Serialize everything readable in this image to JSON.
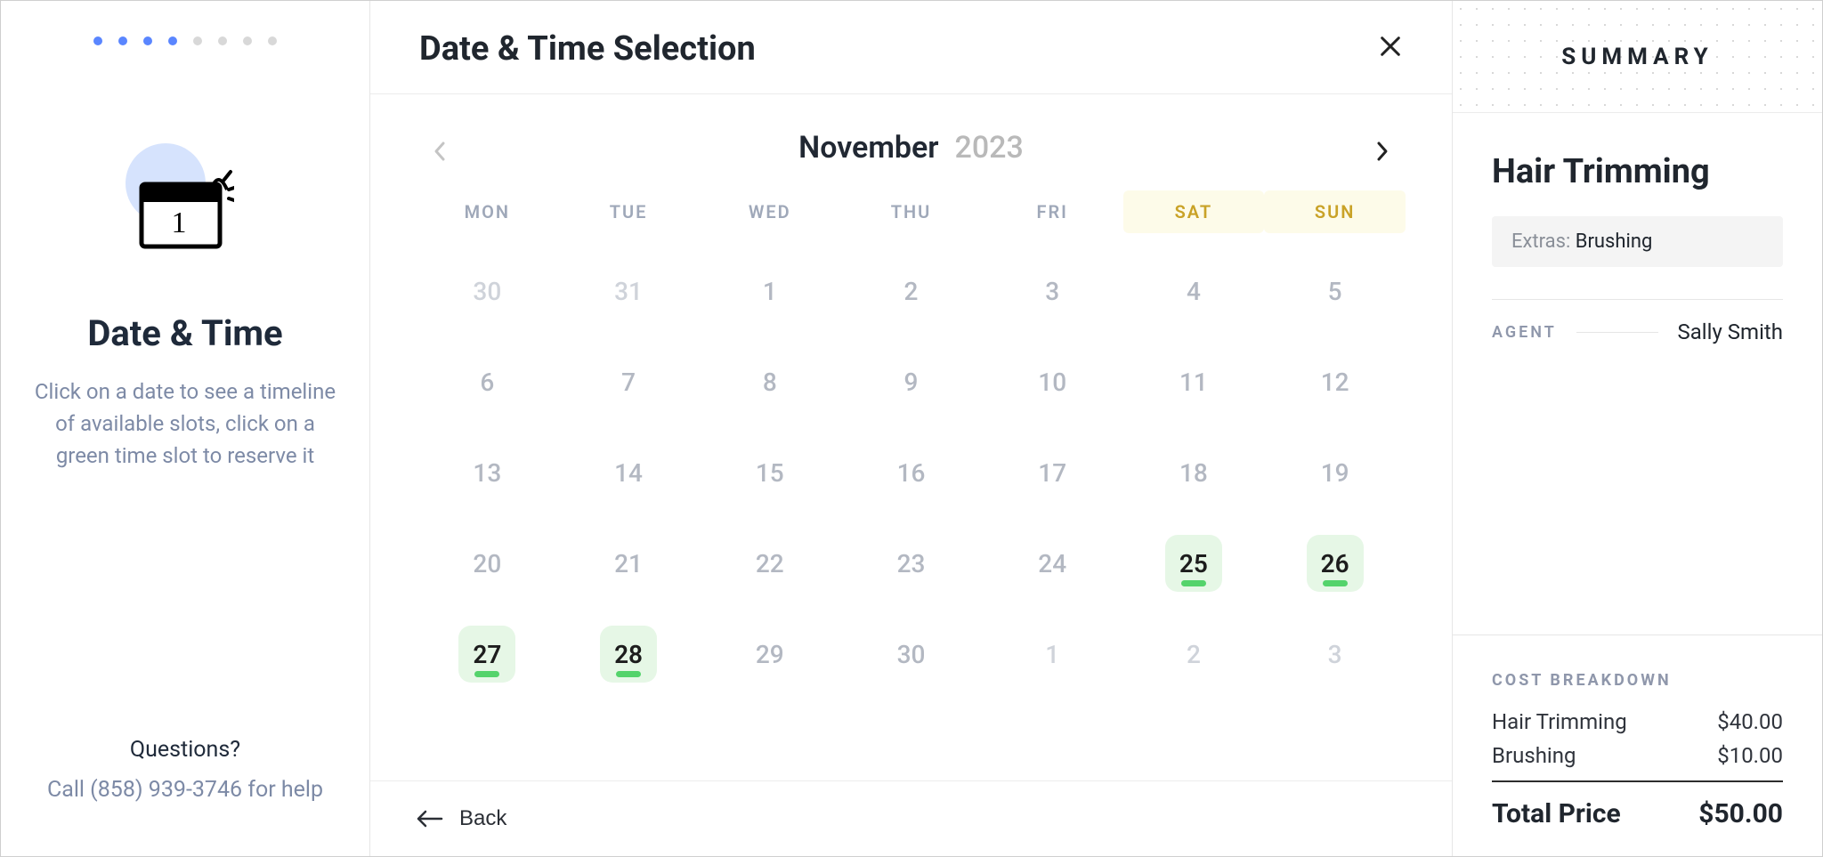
{
  "stepper": {
    "total": 8,
    "active": 4
  },
  "left": {
    "title": "Date & Time",
    "description": "Click on a date to see a timeline of available slots, click on a green time slot to reserve it",
    "questions": "Questions?",
    "help_line": "Call (858) 939-3746 for help"
  },
  "center": {
    "title": "Date & Time Selection",
    "back_label": "Back",
    "month": "November",
    "year": "2023",
    "weekdays": [
      "MON",
      "TUE",
      "WED",
      "THU",
      "FRI",
      "SAT",
      "SUN"
    ],
    "weekend_cols": [
      5,
      6
    ],
    "cells": [
      {
        "n": "30",
        "out": true
      },
      {
        "n": "31",
        "out": true
      },
      {
        "n": "1"
      },
      {
        "n": "2"
      },
      {
        "n": "3"
      },
      {
        "n": "4"
      },
      {
        "n": "5"
      },
      {
        "n": "6"
      },
      {
        "n": "7"
      },
      {
        "n": "8"
      },
      {
        "n": "9"
      },
      {
        "n": "10"
      },
      {
        "n": "11"
      },
      {
        "n": "12"
      },
      {
        "n": "13"
      },
      {
        "n": "14"
      },
      {
        "n": "15"
      },
      {
        "n": "16"
      },
      {
        "n": "17"
      },
      {
        "n": "18"
      },
      {
        "n": "19"
      },
      {
        "n": "20"
      },
      {
        "n": "21"
      },
      {
        "n": "22"
      },
      {
        "n": "23"
      },
      {
        "n": "24"
      },
      {
        "n": "25",
        "avail": true
      },
      {
        "n": "26",
        "avail": true
      },
      {
        "n": "27",
        "avail": true
      },
      {
        "n": "28",
        "avail": true
      },
      {
        "n": "29"
      },
      {
        "n": "30"
      },
      {
        "n": "1",
        "out": true
      },
      {
        "n": "2",
        "out": true
      },
      {
        "n": "3",
        "out": true
      }
    ]
  },
  "summary": {
    "heading": "SUMMARY",
    "service": "Hair Trimming",
    "extras_label": "Extras:",
    "extras_value": "Brushing",
    "agent_label": "AGENT",
    "agent_name": "Sally Smith",
    "cost_heading": "COST BREAKDOWN",
    "items": [
      {
        "name": "Hair Trimming",
        "price": "$40.00"
      },
      {
        "name": "Brushing",
        "price": "$10.00"
      }
    ],
    "total_label": "Total Price",
    "total_value": "$50.00"
  }
}
